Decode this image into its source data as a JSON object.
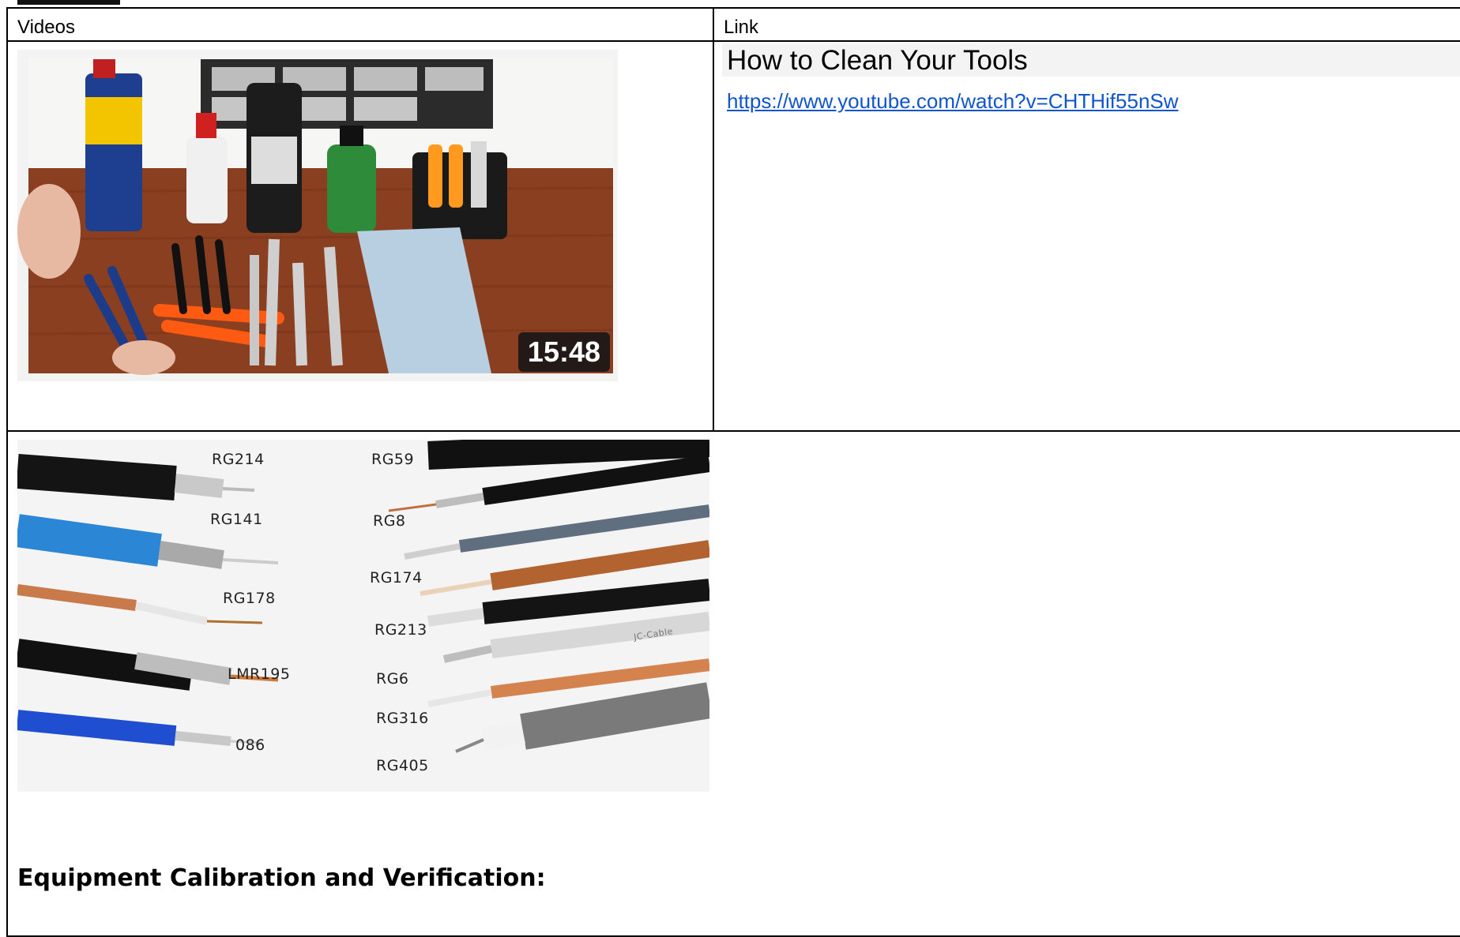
{
  "table": {
    "header": {
      "videos": "Videos",
      "link": "Link"
    },
    "rows": [
      {
        "thumbnail_duration": "15:48",
        "title": "How to Clean Your Tools",
        "url": "https://www.youtube.com/watch?v=CHTHif55nSw"
      }
    ]
  },
  "cable_image": {
    "labels_left": [
      "RG214",
      "RG141",
      "RG178",
      "LMR195",
      "086"
    ],
    "labels_right": [
      "RG59",
      "RG8",
      "RG174",
      "RG213",
      "RG6",
      "RG316",
      "RG405"
    ],
    "brand_mark": "JC-Cable"
  },
  "section": {
    "heading": "Equipment Calibration and Verification:"
  },
  "colors": {
    "link": "#1155cc",
    "border": "#000000"
  }
}
